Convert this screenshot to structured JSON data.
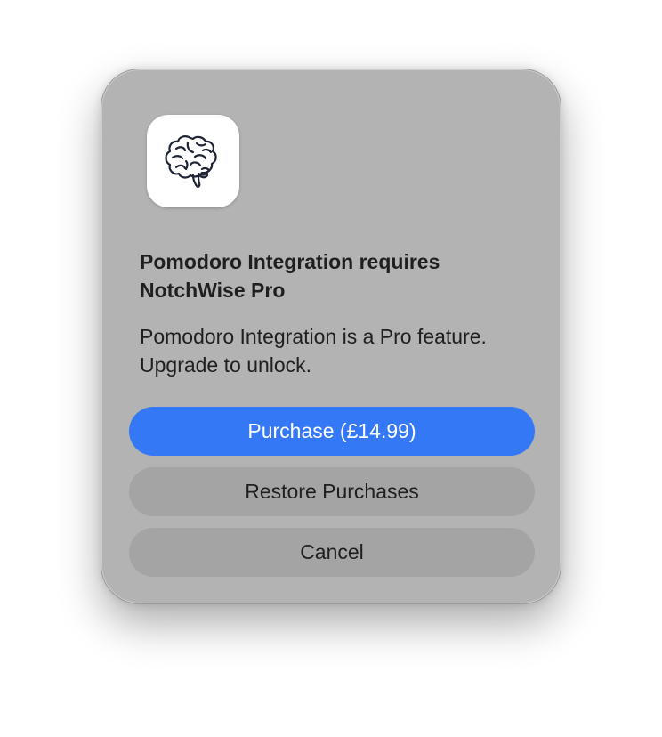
{
  "dialog": {
    "app_icon": "brain-icon",
    "title": "Pomodoro Integration requires NotchWise Pro",
    "message": "Pomodoro Integration is a Pro feature. Upgrade to unlock.",
    "buttons": {
      "purchase_label": "Purchase (£14.99)",
      "restore_label": "Restore Purchases",
      "cancel_label": "Cancel"
    }
  },
  "colors": {
    "accent": "#3478f6",
    "dialog_background": "#b3b3b3",
    "secondary_button": "#a4a4a4"
  }
}
